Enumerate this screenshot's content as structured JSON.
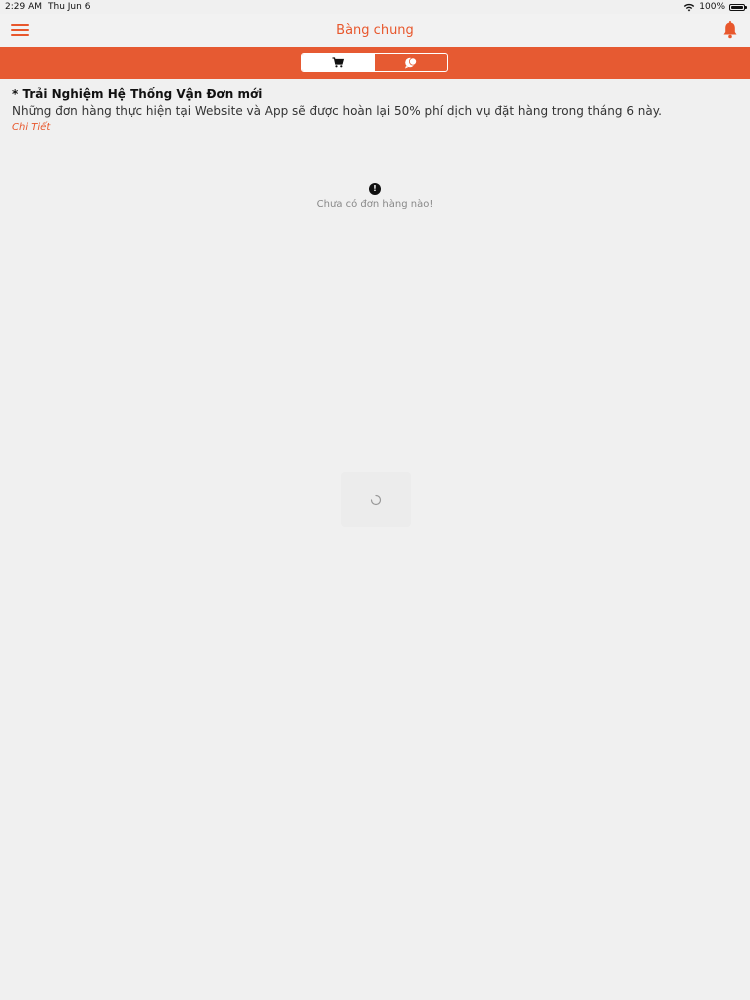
{
  "status_bar": {
    "time": "2:29 AM",
    "date": "Thu Jun 6",
    "battery": "100%",
    "icons": [
      "wifi-icon",
      "battery-icon"
    ]
  },
  "nav": {
    "title": "Bàng chung",
    "menu_icon": "hamburger-icon",
    "bell_icon": "bell-icon"
  },
  "segment": {
    "items": [
      {
        "icon": "cart-icon",
        "active": true
      },
      {
        "icon": "chat-icon",
        "active": false
      }
    ]
  },
  "notice": {
    "title": "* Trải Nghiệm Hệ Thống Vận Đơn mới",
    "body": "Những đơn hàng thực hiện tại Website và App sẽ được hoàn lại 50% phí dịch vụ đặt hàng trong tháng 6 này.",
    "link": "Chi Tiết"
  },
  "empty_state": {
    "icon_glyph": "!",
    "text": "Chưa có đơn hàng nào!"
  },
  "colors": {
    "accent": "#e8572c",
    "segment_bg": "#e65a32",
    "background": "#f0f0f0"
  }
}
